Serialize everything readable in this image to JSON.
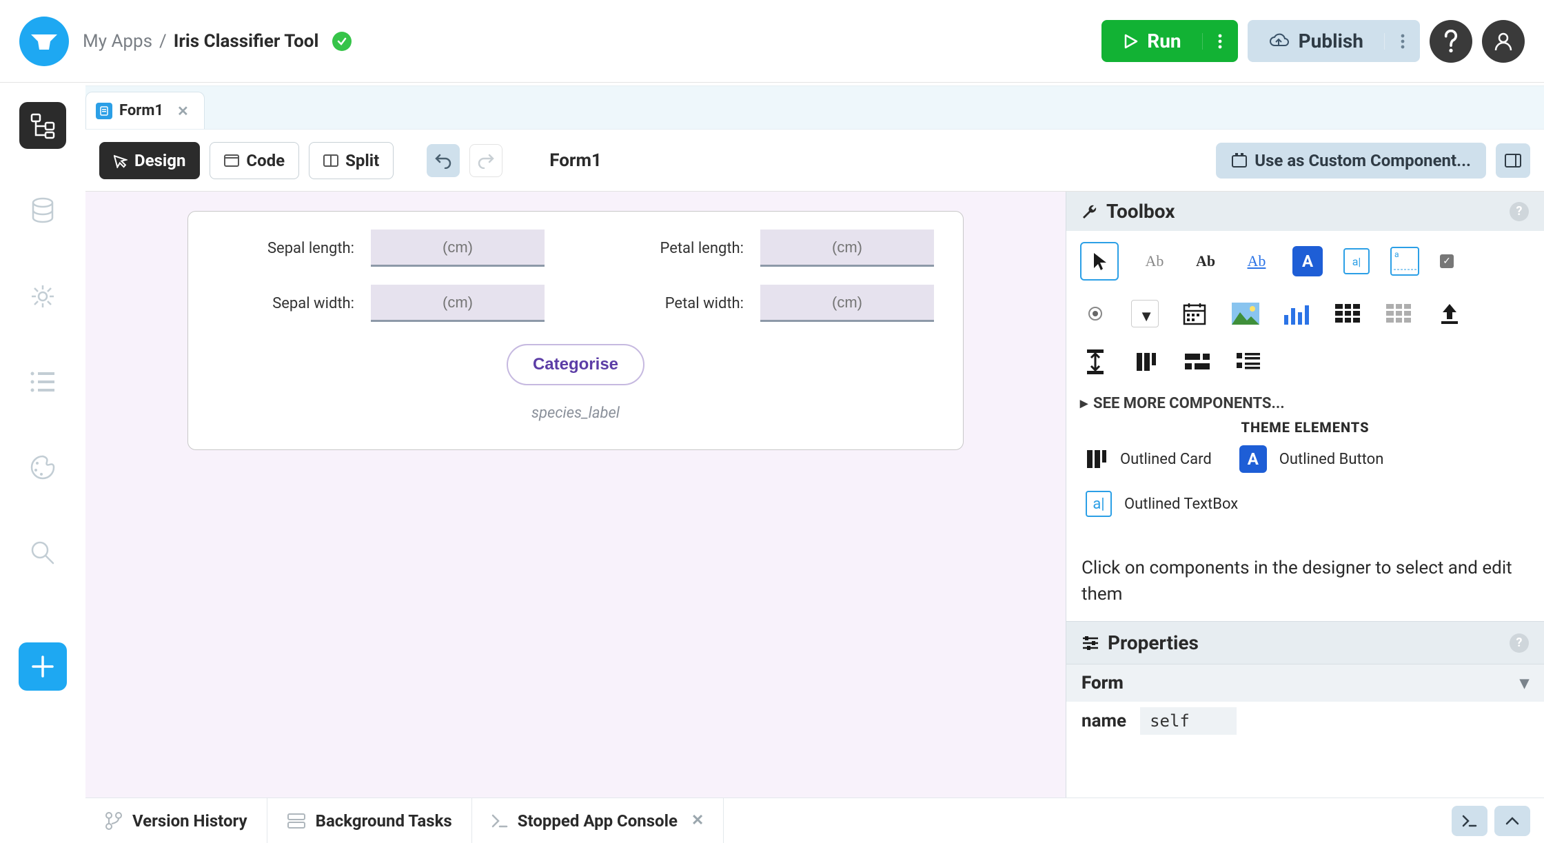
{
  "header": {
    "breadcrumb_root": "My Apps",
    "breadcrumb_sep": "/",
    "app_name": "Iris Classifier Tool",
    "run_label": "Run",
    "publish_label": "Publish"
  },
  "tabs": {
    "form_tab": "Form1"
  },
  "toolbar": {
    "design": "Design",
    "code": "Code",
    "split": "Split",
    "form_title": "Form1",
    "custom_component": "Use as Custom Component..."
  },
  "form": {
    "sepal_length_label": "Sepal length:",
    "sepal_width_label": "Sepal width:",
    "petal_length_label": "Petal length:",
    "petal_width_label": "Petal width:",
    "placeholder_cm": "(cm)",
    "button_label": "Categorise",
    "species_label": "species_label"
  },
  "toolbox": {
    "title": "Toolbox",
    "more": "SEE MORE COMPONENTS...",
    "theme_header": "THEME ELEMENTS",
    "theme_outlined_card": "Outlined Card",
    "theme_outlined_button": "Outlined Button",
    "theme_outlined_textbox": "Outlined TextBox",
    "instruction": "Click on components in the designer to select and edit them"
  },
  "properties": {
    "title": "Properties",
    "form_section": "Form",
    "name_key": "name",
    "name_value": "self"
  },
  "bottom": {
    "version_history": "Version History",
    "background_tasks": "Background Tasks",
    "console": "Stopped App Console"
  }
}
